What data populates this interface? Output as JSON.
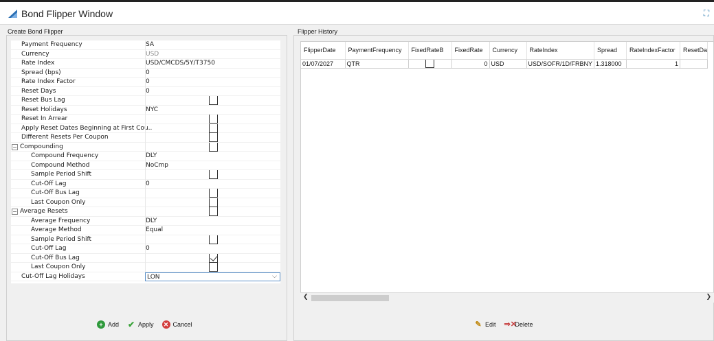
{
  "window": {
    "title": "Bond Flipper Window"
  },
  "left_panel": {
    "title": "Create Bond Flipper",
    "rows": [
      {
        "label": "Payment Frequency",
        "value": "SA",
        "indent": 0
      },
      {
        "label": "Currency",
        "value": "USD",
        "indent": 0,
        "gray": true
      },
      {
        "label": "Rate Index",
        "value": "USD/CMCDS/5Y/T3750",
        "indent": 0
      },
      {
        "label": "Spread (bps)",
        "value": "0",
        "indent": 0
      },
      {
        "label": "Rate Index Factor",
        "value": "0",
        "indent": 0
      },
      {
        "label": "Reset Days",
        "value": "0",
        "indent": 0
      },
      {
        "label": "Reset Bus Lag",
        "value": "",
        "indent": 0,
        "checkbox": false
      },
      {
        "label": "Reset Holidays",
        "value": "NYC",
        "indent": 0
      },
      {
        "label": "Reset In Arrear",
        "value": "",
        "indent": 0,
        "checkbox": false
      },
      {
        "label": "Apply Reset Dates Beginning at First Cou...",
        "value": "",
        "indent": 0,
        "checkbox": false
      },
      {
        "label": "Different Resets Per Coupon",
        "value": "",
        "indent": 0,
        "checkbox": false
      },
      {
        "label": "Compounding",
        "value": "",
        "indent": 0,
        "group": true,
        "checkbox": false
      },
      {
        "label": "Compound Frequency",
        "value": "DLY",
        "indent": 1
      },
      {
        "label": "Compound Method",
        "value": "NoCmp",
        "indent": 1
      },
      {
        "label": "Sample Period Shift",
        "value": "",
        "indent": 1,
        "checkbox": false
      },
      {
        "label": "Cut-Off Lag",
        "value": "0",
        "indent": 1
      },
      {
        "label": "Cut-Off Bus Lag",
        "value": "",
        "indent": 1,
        "checkbox": false
      },
      {
        "label": "Last Coupon Only",
        "value": "",
        "indent": 1,
        "checkbox": false
      },
      {
        "label": "Average Resets",
        "value": "",
        "indent": 0,
        "group": true,
        "checkbox": false
      },
      {
        "label": "Average Frequency",
        "value": "DLY",
        "indent": 1
      },
      {
        "label": "Average Method",
        "value": "Equal",
        "indent": 1
      },
      {
        "label": "Sample Period Shift",
        "value": "",
        "indent": 1,
        "checkbox": false
      },
      {
        "label": "Cut-Off Lag",
        "value": "0",
        "indent": 1
      },
      {
        "label": "Cut-Off Bus Lag",
        "value": "",
        "indent": 1,
        "checkbox": true
      },
      {
        "label": "Last Coupon Only",
        "value": "",
        "indent": 1,
        "checkbox": false
      },
      {
        "label": "Cut-Off Lag Holidays",
        "value": "LON",
        "indent": 0,
        "select": true
      }
    ],
    "buttons": {
      "add": "Add",
      "apply": "Apply",
      "cancel": "Cancel"
    }
  },
  "right_panel": {
    "title": "Flipper History",
    "columns": [
      "FlipperDate",
      "PaymentFrequency",
      "FixedRateB",
      "FixedRate",
      "Currency",
      "RateIndex",
      "Spread",
      "RateIndexFactor",
      "ResetDa"
    ],
    "rows": [
      {
        "FlipperDate": "01/07/2027",
        "PaymentFrequency": "QTR",
        "FixedRateB": false,
        "FixedRate": "0",
        "Currency": "USD",
        "RateIndex": "USD/SOFR/1D/FRBNY",
        "Spread": "1.318000",
        "RateIndexFactor": "1",
        "ResetDa": ""
      }
    ],
    "buttons": {
      "edit": "Edit",
      "delete": "Delete"
    }
  },
  "icons": {
    "title": "app-logo-icon",
    "maximize": "maximize-icon",
    "add": "add-icon",
    "apply": "checkmark-icon",
    "cancel": "cancel-icon",
    "edit": "pencil-icon",
    "delete": "delete-icon"
  }
}
